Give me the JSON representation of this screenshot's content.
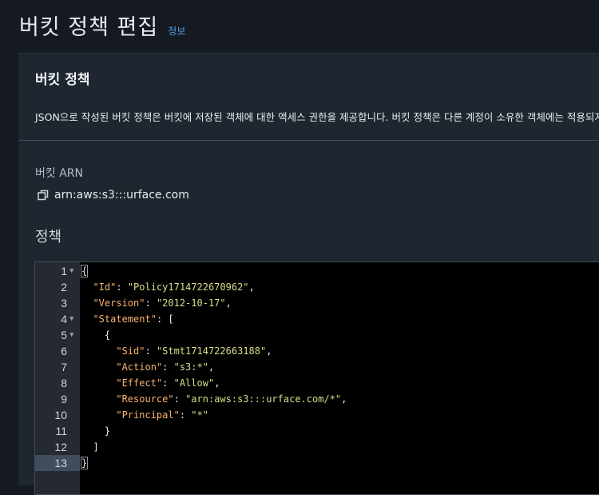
{
  "page": {
    "title": "버킷 정책 편집",
    "info_link": "정보"
  },
  "panel": {
    "title": "버킷 정책",
    "description": "JSON으로 작성된 버킷 정책은 버킷에 저장된 객체에 대한 액세스 권한을 제공합니다. 버킷 정책은 다른 계정이 소유한 객체에는 적용되지"
  },
  "arn": {
    "label": "버킷 ARN",
    "value": "arn:aws:s3:::urface.com",
    "icon": "copy-icon"
  },
  "policy": {
    "label": "정책"
  },
  "editor": {
    "active_line": 13,
    "lines": [
      {
        "n": "1",
        "fold": true,
        "tokens": [
          {
            "t": "{",
            "c": "p"
          }
        ]
      },
      {
        "n": "2",
        "fold": false,
        "tokens": [
          {
            "t": "  ",
            "c": "p"
          },
          {
            "t": "\"Id\"",
            "c": "k"
          },
          {
            "t": ": ",
            "c": "p"
          },
          {
            "t": "\"Policy1714722670962\"",
            "c": "s"
          },
          {
            "t": ",",
            "c": "p"
          }
        ]
      },
      {
        "n": "3",
        "fold": false,
        "tokens": [
          {
            "t": "  ",
            "c": "p"
          },
          {
            "t": "\"Version\"",
            "c": "k"
          },
          {
            "t": ": ",
            "c": "p"
          },
          {
            "t": "\"2012-10-17\"",
            "c": "s"
          },
          {
            "t": ",",
            "c": "p"
          }
        ]
      },
      {
        "n": "4",
        "fold": true,
        "tokens": [
          {
            "t": "  ",
            "c": "p"
          },
          {
            "t": "\"Statement\"",
            "c": "k"
          },
          {
            "t": ": [",
            "c": "p"
          }
        ]
      },
      {
        "n": "5",
        "fold": true,
        "tokens": [
          {
            "t": "    {",
            "c": "p"
          }
        ]
      },
      {
        "n": "6",
        "fold": false,
        "tokens": [
          {
            "t": "      ",
            "c": "p"
          },
          {
            "t": "\"Sid\"",
            "c": "k"
          },
          {
            "t": ": ",
            "c": "p"
          },
          {
            "t": "\"Stmt1714722663188\"",
            "c": "s"
          },
          {
            "t": ",",
            "c": "p"
          }
        ]
      },
      {
        "n": "7",
        "fold": false,
        "tokens": [
          {
            "t": "      ",
            "c": "p"
          },
          {
            "t": "\"Action\"",
            "c": "k"
          },
          {
            "t": ": ",
            "c": "p"
          },
          {
            "t": "\"s3:*\"",
            "c": "s"
          },
          {
            "t": ",",
            "c": "p"
          }
        ]
      },
      {
        "n": "8",
        "fold": false,
        "tokens": [
          {
            "t": "      ",
            "c": "p"
          },
          {
            "t": "\"Effect\"",
            "c": "k"
          },
          {
            "t": ": ",
            "c": "p"
          },
          {
            "t": "\"Allow\"",
            "c": "s"
          },
          {
            "t": ",",
            "c": "p"
          }
        ]
      },
      {
        "n": "9",
        "fold": false,
        "tokens": [
          {
            "t": "      ",
            "c": "p"
          },
          {
            "t": "\"Resource\"",
            "c": "k"
          },
          {
            "t": ": ",
            "c": "p"
          },
          {
            "t": "\"arn:aws:s3:::urface.com/*\"",
            "c": "s"
          },
          {
            "t": ",",
            "c": "p"
          }
        ]
      },
      {
        "n": "10",
        "fold": false,
        "tokens": [
          {
            "t": "      ",
            "c": "p"
          },
          {
            "t": "\"Principal\"",
            "c": "k"
          },
          {
            "t": ": ",
            "c": "p"
          },
          {
            "t": "\"*\"",
            "c": "s"
          }
        ]
      },
      {
        "n": "11",
        "fold": false,
        "tokens": [
          {
            "t": "    }",
            "c": "p"
          }
        ]
      },
      {
        "n": "12",
        "fold": false,
        "tokens": [
          {
            "t": "  ]",
            "c": "p"
          }
        ]
      },
      {
        "n": "13",
        "fold": false,
        "tokens": [
          {
            "t": "}",
            "c": "p"
          }
        ]
      }
    ]
  }
}
